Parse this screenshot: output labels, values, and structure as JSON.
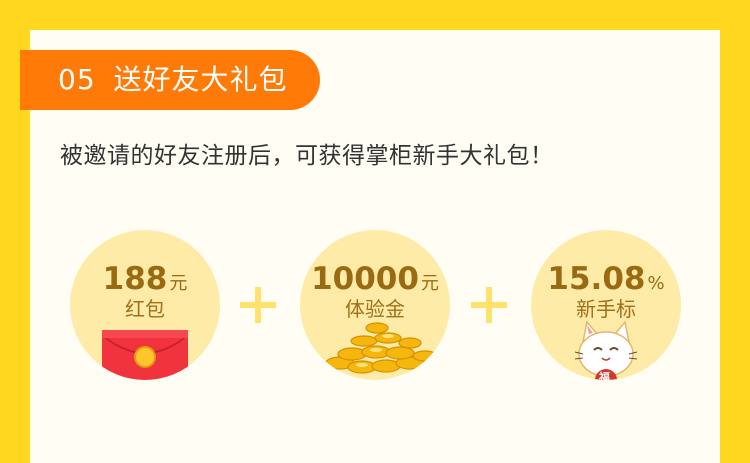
{
  "section": {
    "number": "05",
    "title": "送好友大礼包"
  },
  "intro": "被邀请的好友注册后，可获得掌柜新手大礼包！",
  "gifts": [
    {
      "value": "188",
      "unit": "元",
      "label": "红包",
      "icon": "red-envelope-icon"
    },
    {
      "value": "10000",
      "unit": "元",
      "label": "体验金",
      "icon": "gold-coins-icon"
    },
    {
      "value": "15.08",
      "unit": "%",
      "label": "新手标",
      "icon": "lucky-cat-icon",
      "badge": "福"
    }
  ],
  "colors": {
    "background": "#FFD71E",
    "banner": "#FF7A06",
    "circle": "#FFEBA8",
    "text_accent": "#9A6A12",
    "plus": "#FFE26C"
  }
}
